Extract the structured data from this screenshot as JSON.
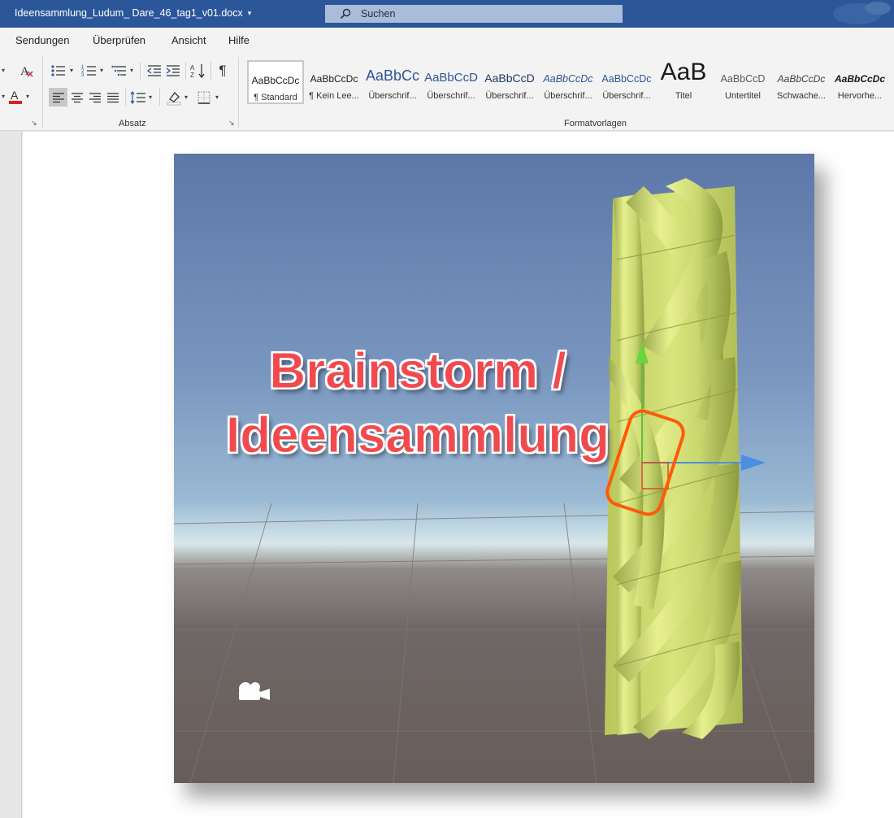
{
  "titlebar": {
    "doc_title": "Ideensammlung_Ludum_ Dare_46_tag1_v01.docx",
    "doc_caret": "▾",
    "search_label": "Suchen"
  },
  "menu": {
    "tabs": [
      "Sendungen",
      "Überprüfen",
      "Ansicht",
      "Hilfe"
    ]
  },
  "ribbon": {
    "groups": {
      "absatz": "Absatz",
      "formatvorlagen": "Formatvorlagen"
    },
    "styles": [
      {
        "sample": "AaBbCcDc",
        "name": "¶ Standard"
      },
      {
        "sample": "AaBbCcDc",
        "name": "¶ Kein Lee..."
      },
      {
        "sample": "AaBbCc",
        "name": "Überschrif..."
      },
      {
        "sample": "AaBbCcD",
        "name": "Überschrif..."
      },
      {
        "sample": "AaBbCcD",
        "name": "Überschrif..."
      },
      {
        "sample": "AaBbCcDc",
        "name": "Überschrif..."
      },
      {
        "sample": "AaBbCcDc",
        "name": "Überschrif..."
      },
      {
        "sample": "AaB",
        "name": "Titel"
      },
      {
        "sample": "AaBbCcD",
        "name": "Untertitel"
      },
      {
        "sample": "AaBbCcDc",
        "name": "Schwache..."
      },
      {
        "sample": "AaBbCcDc",
        "name": "Hervorhe..."
      }
    ],
    "pilcrow": "¶",
    "launcher": "↘"
  },
  "image": {
    "caption_line1": "Brainstorm /",
    "caption_line2": "Ideensammlung"
  },
  "colors": {
    "titlebar": "#2b579a",
    "caption": "#f04a4e",
    "tower": "#d4e57a"
  }
}
